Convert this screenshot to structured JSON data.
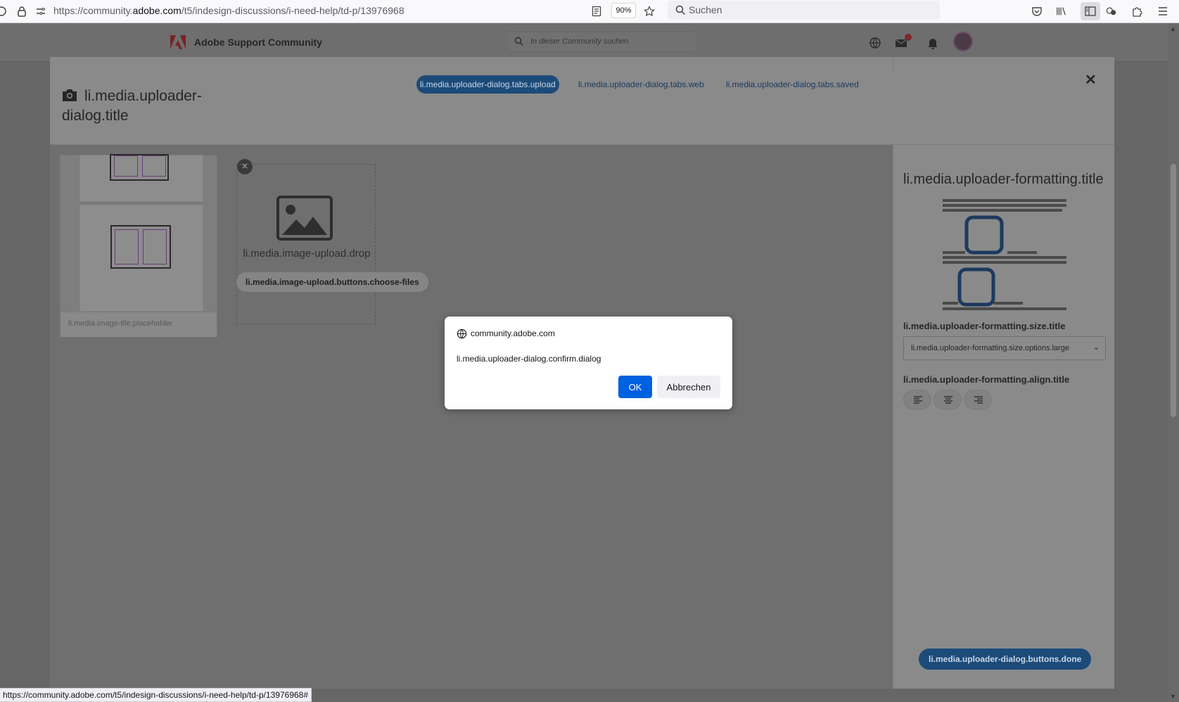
{
  "browser": {
    "url_prefix": "https://community.",
    "url_domain": "adobe.com",
    "url_path": "/t5/indesign-discussions/i-need-help/td-p/13976968",
    "zoom": "90%",
    "search_placeholder": "Suchen"
  },
  "site": {
    "title": "Adobe Support Community",
    "search_placeholder": "In dieser Community suchen"
  },
  "uploader": {
    "title": "li.media.uploader-dialog.title",
    "tabs": [
      {
        "label": "li.media.uploader-dialog.tabs.upload",
        "active": true
      },
      {
        "label": "li.media.uploader-dialog.tabs.web",
        "active": false
      },
      {
        "label": "li.media.uploader-dialog.tabs.saved",
        "active": false
      }
    ],
    "close_glyph": "✕",
    "tile_placeholder": "li.media.image-tile.placeholder",
    "drop_text": "li.media.image-upload.drop",
    "choose_files": "li.media.image-upload.buttons.choose-files",
    "formatting": {
      "title": "li.media.uploader-formatting.title",
      "size_title": "li.media.uploader-formatting.size.title",
      "size_selected": "li.media.uploader-formatting.size.options.large",
      "align_title": "li.media.uploader-formatting.align.title"
    },
    "done": "li.media.uploader-dialog.buttons.done"
  },
  "confirm_dialog": {
    "origin": "community.adobe.com",
    "message": "li.media.uploader-dialog.confirm.dialog",
    "ok": "OK",
    "cancel": "Abbrechen"
  },
  "status_bar": "https://community.adobe.com/t5/indesign-discussions/i-need-help/td-p/13976968#",
  "colors": {
    "accent": "#0061e0",
    "tab_active": "#1c4b7a",
    "overlay": "#666666"
  }
}
